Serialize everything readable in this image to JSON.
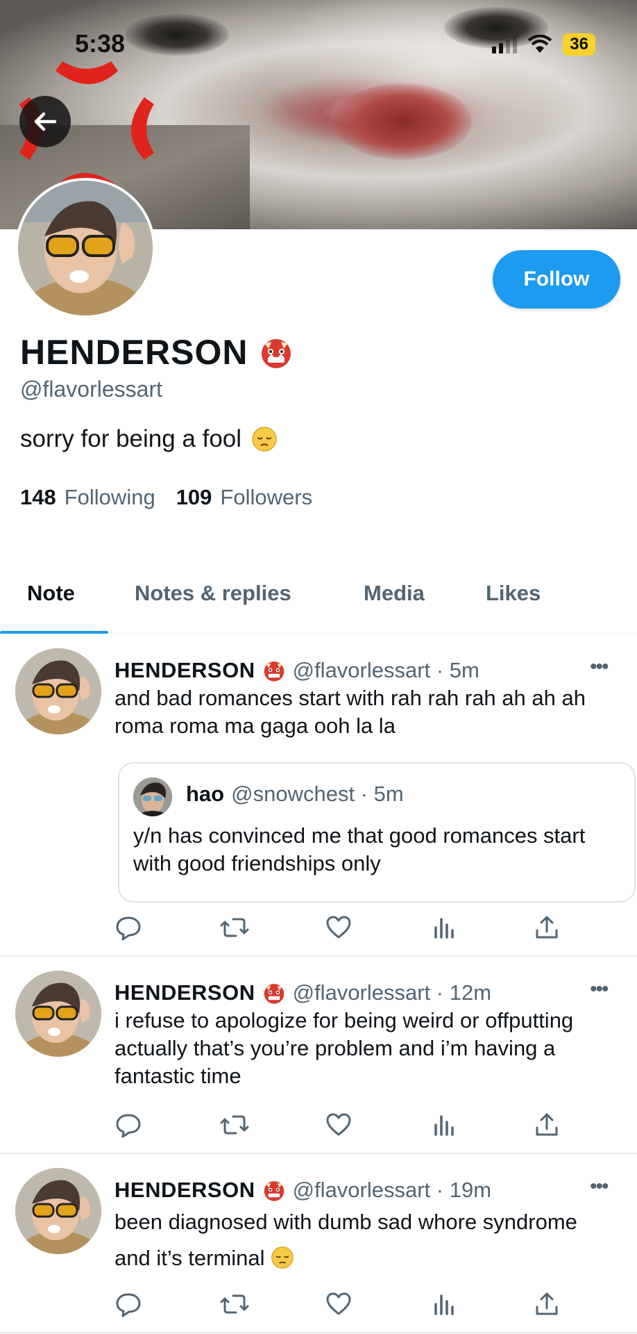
{
  "status_bar": {
    "time": "5:38",
    "battery": "36"
  },
  "profile": {
    "name": "HENDERSON",
    "name_emoji": "ogre-emoji",
    "handle": "@flavorlessart",
    "bio": "sorry for being a fool",
    "bio_emoji": "pensive-face-emoji",
    "following_count": "148",
    "following_label": "Following",
    "followers_count": "109",
    "followers_label": "Followers",
    "follow_button": "Follow"
  },
  "tabs": [
    {
      "label": "Note",
      "active": true
    },
    {
      "label": "Notes & replies",
      "active": false
    },
    {
      "label": "Media",
      "active": false
    },
    {
      "label": "Likes",
      "active": false
    }
  ],
  "posts": [
    {
      "name": "HENDERSON",
      "meta": "@flavorlessart · 5m",
      "text": "and bad romances start with rah rah rah ah ah ah roma roma ma gaga ooh la la",
      "quote": {
        "name": "hao",
        "meta": "@snowchest · 5m",
        "text": "y/n has convinced me that good romances start with good friendships only"
      }
    },
    {
      "name": "HENDERSON",
      "meta": "@flavorlessart · 12m",
      "text": "i refuse to apologize for being weird or offputting actually that’s you’re problem and i’m having a fantastic time"
    },
    {
      "name": "HENDERSON",
      "meta": "@flavorlessart · 19m",
      "text": "been diagnosed with dumb sad whore syndrome and it’s terminal"
    }
  ],
  "more_glyph": "•••",
  "colors": {
    "accent": "#1d9bf0",
    "secondary_text": "#536471"
  }
}
